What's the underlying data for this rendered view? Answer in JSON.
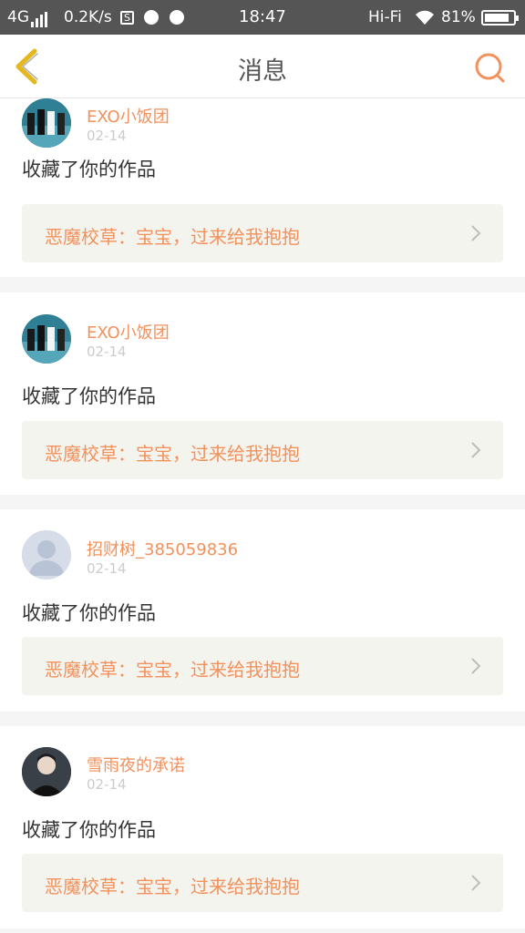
{
  "status_bar": {
    "network": "4G",
    "speed": "0.2K/s",
    "sim_icon": "S",
    "time": "18:47",
    "hifi": "Hi-Fi",
    "battery": "81%"
  },
  "nav": {
    "title": "消息"
  },
  "colors": {
    "accent": "#f2915c",
    "status_bar_bg": "#555555",
    "nav_back": "#e5b81e",
    "link_bg": "#f4f4ee"
  },
  "messages": [
    {
      "username": "EXO小饭团",
      "date": "02-14",
      "action": "收藏了你的作品",
      "work_title": "恶魔校草：宝宝，过来给我抱抱",
      "avatar": "group-photo"
    },
    {
      "username": "EXO小饭团",
      "date": "02-14",
      "action": "收藏了你的作品",
      "work_title": "恶魔校草：宝宝，过来给我抱抱",
      "avatar": "group-photo"
    },
    {
      "username": "招财树_385059836",
      "date": "02-14",
      "action": "收藏了你的作品",
      "work_title": "恶魔校草：宝宝，过来给我抱抱",
      "avatar": "default-avatar"
    },
    {
      "username": "雪雨夜的承诺",
      "date": "02-14",
      "action": "收藏了你的作品",
      "work_title": "恶魔校草：宝宝，过来给我抱抱",
      "avatar": "portrait-photo"
    }
  ]
}
